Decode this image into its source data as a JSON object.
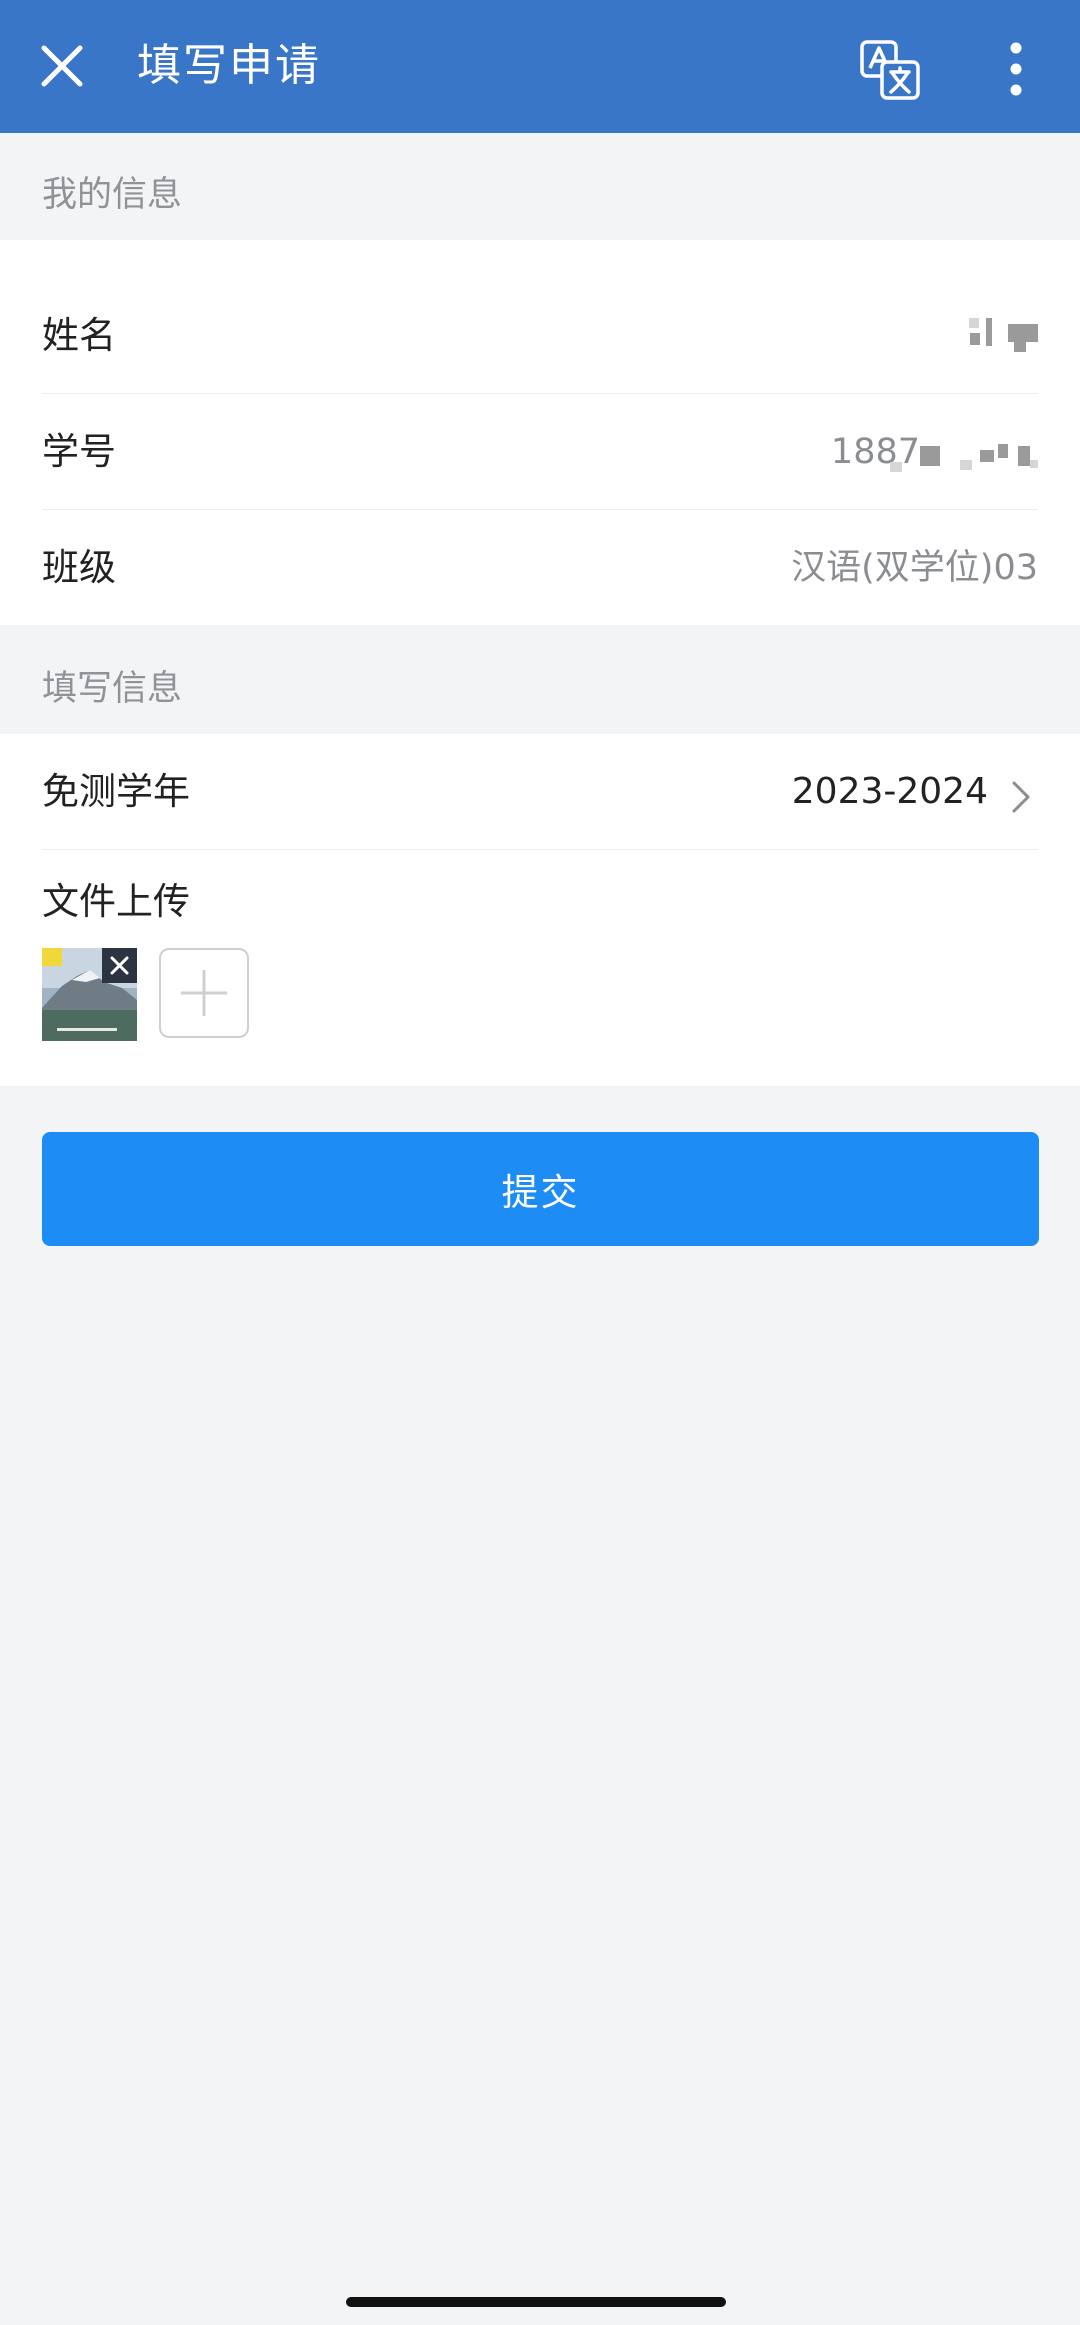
{
  "header": {
    "title": "填写申请",
    "close_icon": "close-icon",
    "translate_icon": "translate-icon",
    "more_icon": "more-vertical-icon",
    "background": "#3a76c8"
  },
  "my_info": {
    "section_title": "我的信息",
    "rows": [
      {
        "label": "姓名",
        "value": ""
      },
      {
        "label": "学号",
        "value": "1887"
      },
      {
        "label": "班级",
        "value": "汉语(双学位)03"
      }
    ]
  },
  "fill_info": {
    "section_title": "填写信息",
    "year_label": "免测学年",
    "year_value": "2023-2024",
    "upload_label": "文件上传"
  },
  "submit": {
    "label": "提交",
    "color": "#1e8cf5"
  }
}
